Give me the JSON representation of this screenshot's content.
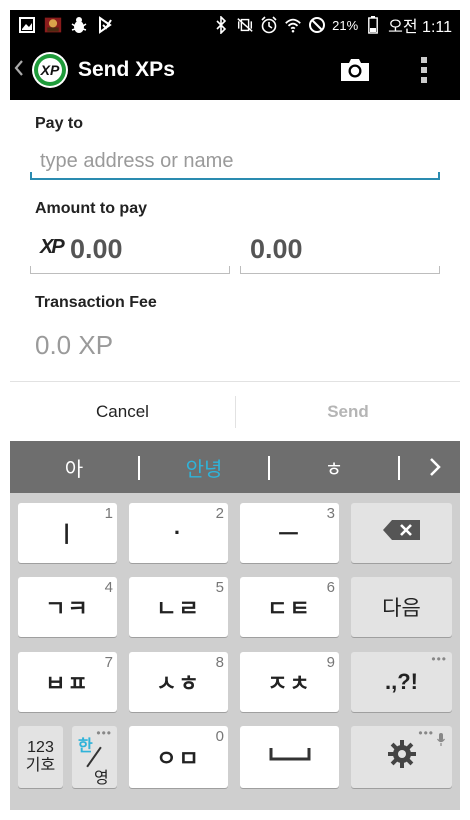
{
  "status_bar": {
    "battery_percent": "21%",
    "time": "오전 1:11"
  },
  "action_bar": {
    "title": "Send XPs",
    "icons": [
      "back-chevron-icon",
      "xp-logo-icon",
      "camera-icon",
      "overflow-menu-icon"
    ]
  },
  "form": {
    "pay_to_label": "Pay to",
    "pay_to_placeholder": "type address or name",
    "amount_label": "Amount to pay",
    "amount_prefix": "XP",
    "amount_xp_value": "0.00",
    "amount_fiat_value": "0.00",
    "fee_label": "Transaction Fee",
    "fee_value": "0.0 XP"
  },
  "buttons": {
    "cancel": "Cancel",
    "send": "Send"
  },
  "keyboard": {
    "suggestions": [
      "아",
      "안녕",
      "ㅎ"
    ],
    "highlight_color": "#2fb3d9",
    "rows": [
      [
        {
          "label": "ㅣ",
          "num": "1"
        },
        {
          "label": "·",
          "num": "2"
        },
        {
          "label": "ㅡ",
          "num": "3"
        }
      ],
      [
        {
          "label": "ㄱㅋ",
          "num": "4"
        },
        {
          "label": "ㄴㄹ",
          "num": "5"
        },
        {
          "label": "ㄷㅌ",
          "num": "6"
        }
      ],
      [
        {
          "label": "ㅂㅍ",
          "num": "7"
        },
        {
          "label": "ㅅㅎ",
          "num": "8"
        },
        {
          "label": "ㅈㅊ",
          "num": "9"
        }
      ],
      [
        {
          "label": "ㅇㅁ",
          "num": "0"
        }
      ]
    ],
    "next_key": "다음",
    "punct_key": ".,?!",
    "mode_key_top": "123",
    "mode_key_bottom": "기호",
    "lang_key_top": "한",
    "lang_key_bottom": "영"
  }
}
